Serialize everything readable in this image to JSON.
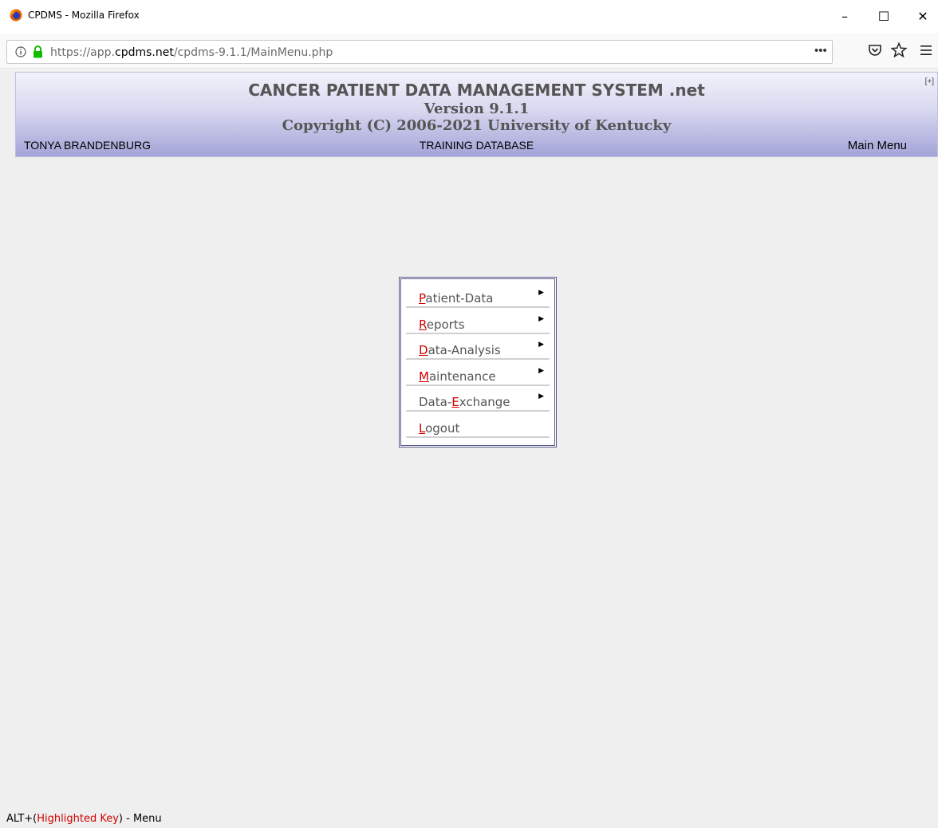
{
  "window": {
    "title": "CPDMS - Mozilla Firefox",
    "controls": {
      "minimize": "–",
      "maximize": "☐",
      "close": "✕"
    }
  },
  "browser": {
    "url_prefix": "https://app.",
    "url_domain": "cpdms.net",
    "url_path": "/cpdms-9.1.1/MainMenu.php",
    "icons": [
      "info-icon",
      "lock-icon",
      "more-icon",
      "pocket-icon",
      "star-icon",
      "menu-icon"
    ]
  },
  "header": {
    "title": "CANCER PATIENT DATA MANAGEMENT SYSTEM .net",
    "version": "Version 9.1.1",
    "copyright": "Copyright (C) 2006-2021 University of Kentucky",
    "user": "TONYA BRANDENBURG",
    "database": "TRAINING DATABASE",
    "location": "Main Menu",
    "expand": "[+]"
  },
  "menu": {
    "items": [
      {
        "pre": "",
        "key": "P",
        "post": "atient-Data",
        "submenu": true
      },
      {
        "pre": "",
        "key": "R",
        "post": "eports",
        "submenu": true
      },
      {
        "pre": "",
        "key": "D",
        "post": "ata-Analysis",
        "submenu": true
      },
      {
        "pre": "",
        "key": "M",
        "post": "aintenance",
        "submenu": true
      },
      {
        "pre": "Data-",
        "key": "E",
        "post": "xchange",
        "submenu": true
      },
      {
        "pre": "",
        "key": "L",
        "post": "ogout",
        "submenu": false
      }
    ]
  },
  "status": {
    "prefix": "ALT+(",
    "highlight": "Highlighted Key",
    "suffix": ") - Menu"
  },
  "colors": {
    "accent_key": "#d00000",
    "header_gradient_top": "#f2f2fb",
    "header_gradient_bottom": "#a3a3d8",
    "page_bg": "#efefef",
    "menu_border": "#5a5a8c"
  }
}
